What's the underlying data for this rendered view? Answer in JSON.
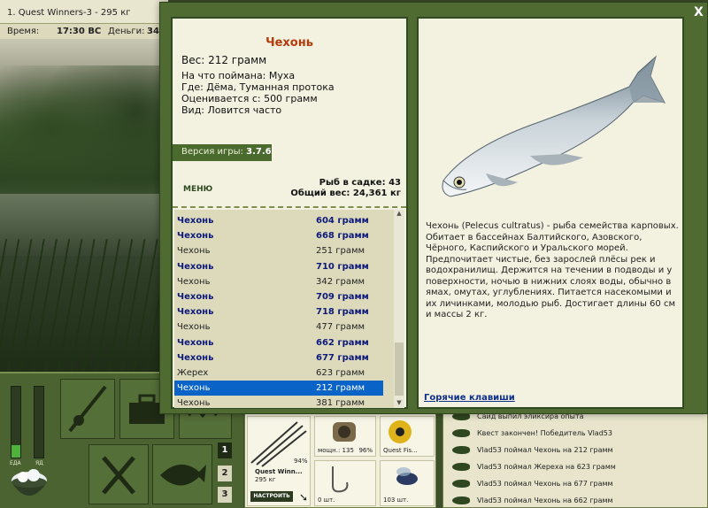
{
  "topbar": {
    "quest": "1. Quest Winners-3 - 295 кг",
    "time_label": "Время:",
    "time_value": "17:30 ВС",
    "money_label": "Деньги:",
    "money_value": "34"
  },
  "gauges": {
    "food_label": "ЕДА",
    "poison_label": "ЯД",
    "food_level": 0.18,
    "poison_level": 0
  },
  "modal": {
    "close_label": "X",
    "fish_name": "Чехонь",
    "weight": "Вес: 212 грамм",
    "bait": "На что поймана: Муха",
    "location": "Где: Дёма, Туманная протока",
    "price": "Оценивается с: 500 грамм",
    "type": "Вид: Ловится часто",
    "version_label": "Версия игры:",
    "version_value": "3.7.6",
    "menu_label": "МЕНЮ",
    "keepnet_count": "Рыб в садке: 43",
    "total_weight": "Общий вес: 24,361 кг",
    "catch_list": [
      {
        "name": "Чехонь",
        "weight": "604 грамм",
        "highlight": true
      },
      {
        "name": "Чехонь",
        "weight": "668 грамм",
        "highlight": true
      },
      {
        "name": "Чехонь",
        "weight": "251 грамм",
        "highlight": false
      },
      {
        "name": "Чехонь",
        "weight": "710 грамм",
        "highlight": true
      },
      {
        "name": "Чехонь",
        "weight": "342 грамм",
        "highlight": false
      },
      {
        "name": "Чехонь",
        "weight": "709 грамм",
        "highlight": true
      },
      {
        "name": "Чехонь",
        "weight": "718 грамм",
        "highlight": true
      },
      {
        "name": "Чехонь",
        "weight": "477 грамм",
        "highlight": false
      },
      {
        "name": "Чехонь",
        "weight": "662 грамм",
        "highlight": true
      },
      {
        "name": "Чехонь",
        "weight": "677 грамм",
        "highlight": true
      },
      {
        "name": "Жерех",
        "weight": "623 грамм",
        "highlight": false
      },
      {
        "name": "Чехонь",
        "weight": "212 грамм",
        "highlight": false,
        "selected": true
      },
      {
        "name": "Чехонь",
        "weight": "381 грамм",
        "highlight": false
      }
    ],
    "description": "Чехонь (Pelecus cultratus) - рыба семейства карповых. Обитает в бассейнах Балтийского, Азовского, Чёрного, Каспийского и Уральского морей. Предпочитает чистые, без зарослей плёсы рек и водохранилищ. Держится на течении в подводы и у поверхности, ночью в нижних слоях воды, обычно в ямах, омутах, углублениях. Питается насекомыми и их личинками, молодью рыб. Достигает длины 60 см и массы 2 кг.",
    "hotkeys_label": "Горячие клавиши"
  },
  "tackle": {
    "rod_name": "Quest Winn...",
    "rod_weight": "295 кг",
    "rod_pct": "94%",
    "setup_label": "НАСТРОИТЬ",
    "reel_caption": "мощн.: 135",
    "reel_pct": "96%",
    "line_caption": "Quest Fis...",
    "hook_caption": "0 шт.",
    "bait_caption": "103 шт."
  },
  "tabs": [
    "1",
    "2",
    "3"
  ],
  "chat": [
    "Саид выпил эликсира опыта",
    "Квест закончен! Победитель Vlad53",
    "Vlad53 поймал Чехонь на 212 грамм",
    "Vlad53 поймал Жереха на 623 грамм",
    "Vlad53 поймал Чехонь на 677 грамм",
    "Vlad53 поймал Чехонь на 662 грамм"
  ]
}
